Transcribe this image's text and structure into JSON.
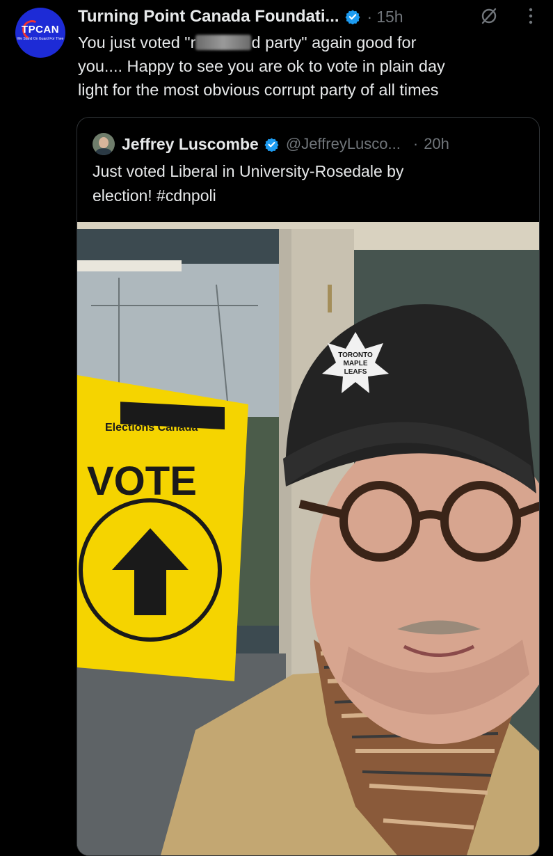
{
  "tweet": {
    "avatar_text": "TPCAN",
    "avatar_subtext": "We Stand On Guard For Thee",
    "author_name": "Turning Point Canada Foundati...",
    "dot": "·",
    "time": "15h",
    "text_line1_pre": "You just voted \"r",
    "text_line1_post": "d party\" again good for",
    "text_line2": "you.... Happy to see you are ok to vote in plain day",
    "text_line3": "light for the most obvious corrupt party of all times"
  },
  "quoted": {
    "author_name": "Jeffrey Luscombe",
    "handle": "@JeffreyLusco...",
    "dot": "·",
    "time": "20h",
    "text_line1": "Just voted Liberal in University-Rosedale by",
    "text_line2": "election! #cdnpoli",
    "image": {
      "sign_org": "Elections Canada",
      "sign_word": "VOTE",
      "hat_logo_line1": "TORONTO",
      "hat_logo_line2": "MAPLE",
      "hat_logo_line3": "LEAFS"
    }
  },
  "colors": {
    "background": "#000000",
    "text": "#e7e9ea",
    "muted": "#71767b",
    "verified": "#1d9bf0",
    "sign_yellow": "#f5d400"
  },
  "icons": [
    "verified-badge-icon",
    "grok-icon",
    "more-icon"
  ]
}
